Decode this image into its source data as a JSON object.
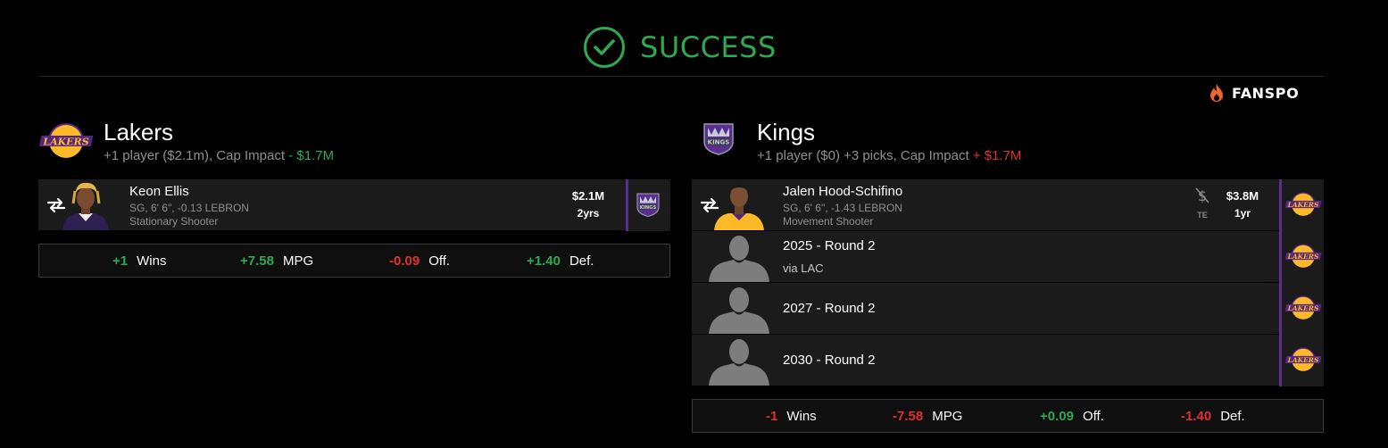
{
  "banner": {
    "status": "SUCCESS",
    "icon": "check-circle-icon",
    "color": "#2fa84f"
  },
  "brand": {
    "name": "FANSPO",
    "icon": "flame-icon",
    "color": "#f0642d"
  },
  "colors": {
    "positive": "#2fa84f",
    "negative": "#e03131",
    "lakers_purple": "#552583",
    "lakers_gold": "#fdb927",
    "kings_purple": "#5a2d91"
  },
  "teams": [
    {
      "name": "Lakers",
      "logo": "lakers-logo-icon",
      "summary_prefix": "+1 player ($2.1m), Cap Impact",
      "cap_impact": "- $1.7M",
      "incoming": [
        {
          "type": "player",
          "name": "Keon Ellis",
          "meta": "SG, 6' 6\", -0.13 LEBRON",
          "role": "Stationary Shooter",
          "salary": "$2.1M",
          "years": "2yrs",
          "from_team_logo": "kings-logo-icon"
        }
      ],
      "stats": [
        {
          "value": "+1",
          "label": "Wins",
          "sign": "positive"
        },
        {
          "value": "+7.58",
          "label": "MPG",
          "sign": "positive"
        },
        {
          "value": "-0.09",
          "label": "Off.",
          "sign": "negative"
        },
        {
          "value": "+1.40",
          "label": "Def.",
          "sign": "positive"
        }
      ]
    },
    {
      "name": "Kings",
      "logo": "kings-logo-icon",
      "summary_prefix": "+1 player ($0) +3 picks, Cap Impact",
      "cap_impact": "+ $1.7M",
      "incoming": [
        {
          "type": "player",
          "name": "Jalen Hood-Schifino",
          "meta": "SG, 6' 6\", -1.43 LEBRON",
          "role": "Movement Shooter",
          "salary": "$3.8M",
          "years": "1yr",
          "flag": "TE",
          "from_team_logo": "lakers-logo-icon"
        },
        {
          "type": "pick",
          "name": "2025 - Round 2",
          "via": "via LAC",
          "from_team_logo": "lakers-logo-icon"
        },
        {
          "type": "pick",
          "name": "2027 - Round 2",
          "from_team_logo": "lakers-logo-icon"
        },
        {
          "type": "pick",
          "name": "2030 - Round 2",
          "from_team_logo": "lakers-logo-icon"
        }
      ],
      "stats": [
        {
          "value": "-1",
          "label": "Wins",
          "sign": "negative"
        },
        {
          "value": "-7.58",
          "label": "MPG",
          "sign": "negative"
        },
        {
          "value": "+0.09",
          "label": "Off.",
          "sign": "positive"
        },
        {
          "value": "-1.40",
          "label": "Def.",
          "sign": "negative"
        }
      ]
    }
  ]
}
